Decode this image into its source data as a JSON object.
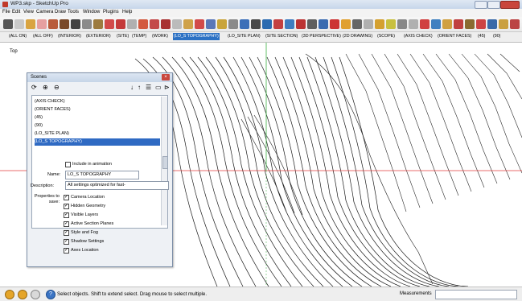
{
  "window": {
    "title": "WP3.skp - SketchUp Pro"
  },
  "menu": [
    "File",
    "Edit",
    "View",
    "Camera",
    "Draw",
    "Tools",
    "Window",
    "Plugins",
    "Help"
  ],
  "scene_tabs": [
    "(ALL ON)",
    "(ALL OFF)",
    "(INTERIOR)",
    "(EXTERIOR)",
    "(SITE)",
    "(TEMP)",
    "(WORK)",
    "(LO_S TOPOGRAPHY)",
    "(LO_SITE PLAN)",
    "(SITE SECTION)",
    "(3D PERSPECTIVE)",
    "(2D DRAWING)",
    "(SCOPE)",
    "(AXIS CHECK)",
    "(ORIENT FACES)",
    "(45)",
    "(90)"
  ],
  "active_tab_index": 7,
  "view_label": "Top",
  "scenes_panel": {
    "title": "Scenes",
    "list": [
      "(AXIS CHECK)",
      "(ORIENT FACES)",
      "(45)",
      "(90)",
      "(LO_SITE PLAN)",
      "(LO_S TOPOGRAPHY)"
    ],
    "selected_index": 5,
    "include_label": "Include in animation",
    "include_checked": false,
    "name_label": "Name:",
    "name_value": "LO_S TOPOGRAPHY",
    "description_label": "Description:",
    "description_value": "All settings optimized for fast-",
    "properties_label": "Properties to save:",
    "properties": [
      {
        "label": "Camera Location",
        "checked": true
      },
      {
        "label": "Hidden Geometry",
        "checked": true
      },
      {
        "label": "Visible Layers",
        "checked": true
      },
      {
        "label": "Active Section Planes",
        "checked": true
      },
      {
        "label": "Style and Fog",
        "checked": true
      },
      {
        "label": "Shadow Settings",
        "checked": true
      },
      {
        "label": "Axes Location",
        "checked": true
      }
    ]
  },
  "status": {
    "text": "Select objects. Shift to extend select. Drag mouse to select multiple.",
    "measurements_label": "Measurements",
    "measurements_value": ""
  },
  "colors": {
    "accent": "#2c71c4",
    "axis_green": "#3cb043",
    "axis_red": "#e03c3c"
  }
}
